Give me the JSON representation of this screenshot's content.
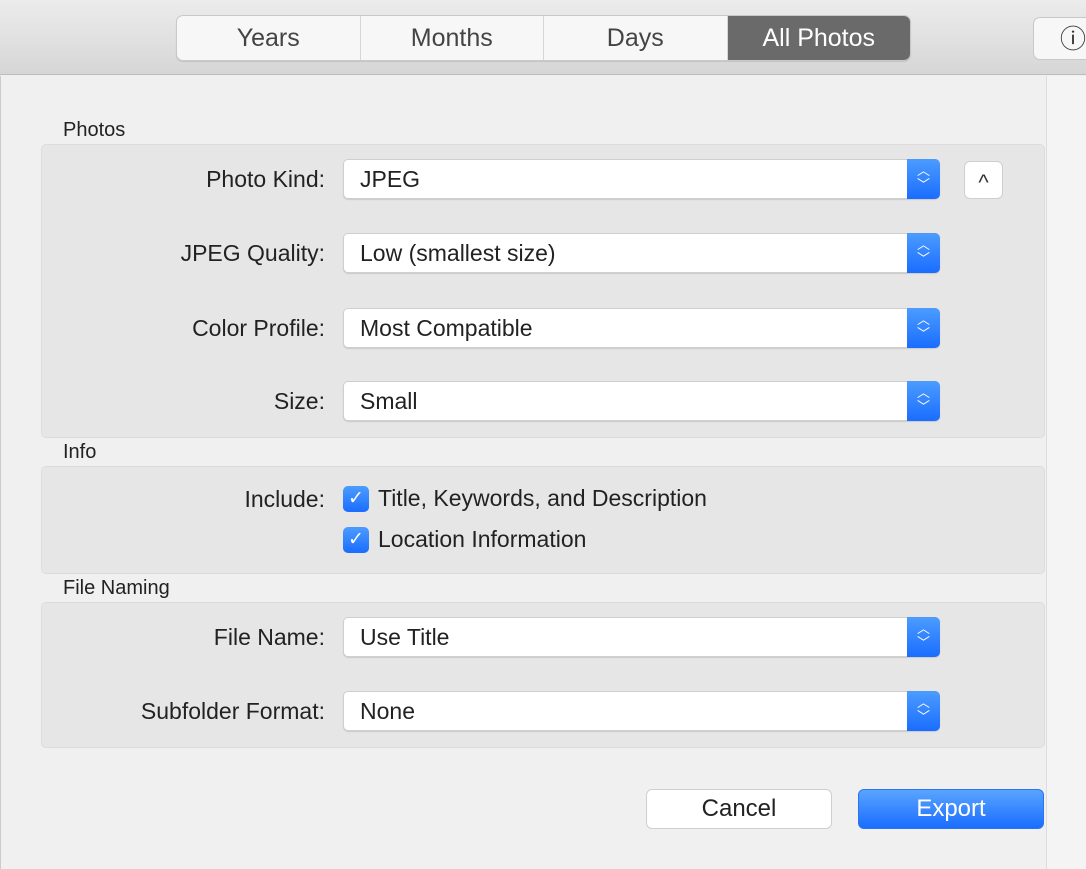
{
  "toolbar": {
    "tabs": [
      "Years",
      "Months",
      "Days",
      "All Photos"
    ],
    "active_tab": "All Photos",
    "info_icon": "info-icon"
  },
  "photos": {
    "title": "Photos",
    "photo_kind": {
      "label": "Photo Kind:",
      "value": "JPEG"
    },
    "jpeg_quality": {
      "label": "JPEG Quality:",
      "value": "Low (smallest size)"
    },
    "color_profile": {
      "label": "Color Profile:",
      "value": "Most Compatible"
    },
    "size": {
      "label": "Size:",
      "value": "Small"
    },
    "collapse_icon": "chevron-up-icon"
  },
  "info": {
    "title": "Info",
    "include_label": "Include:",
    "options": [
      {
        "label": "Title, Keywords, and Description",
        "checked": true
      },
      {
        "label": "Location Information",
        "checked": true
      }
    ]
  },
  "file_naming": {
    "title": "File Naming",
    "file_name": {
      "label": "File Name:",
      "value": "Use Title"
    },
    "subfolder": {
      "label": "Subfolder Format:",
      "value": "None"
    }
  },
  "buttons": {
    "cancel": "Cancel",
    "export": "Export"
  },
  "colors": {
    "accent": "#1a6dff",
    "active_tab": "#6a6a6a"
  }
}
